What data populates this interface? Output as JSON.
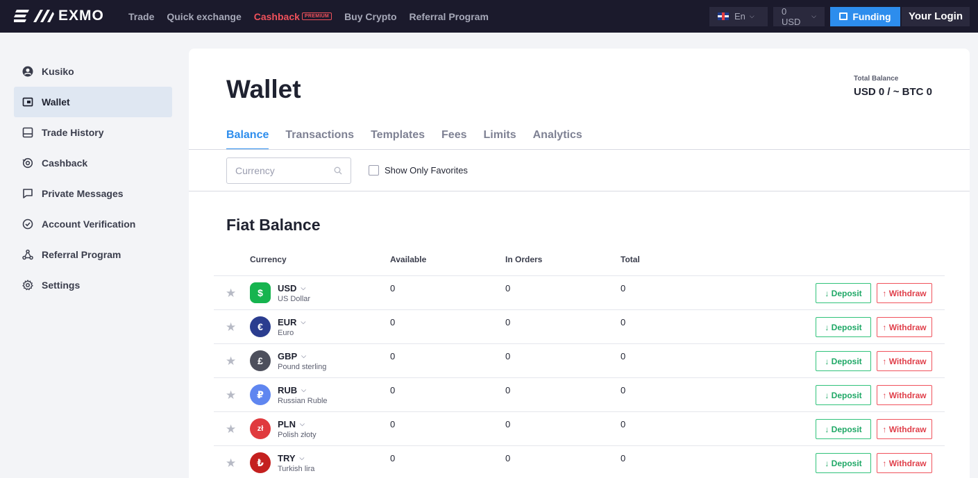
{
  "brand": {
    "name": "EXMO"
  },
  "nav": {
    "items": [
      {
        "label": "Trade"
      },
      {
        "label": "Quick exchange"
      },
      {
        "label": "Cashback"
      },
      {
        "label": "Buy Crypto"
      },
      {
        "label": "Referral Program"
      }
    ],
    "premium_badge": "PREMIUM"
  },
  "topbar": {
    "language": "En",
    "balance": "0 USD",
    "funding_label": "Funding",
    "login_label": "Your Login"
  },
  "sidebar": {
    "items": [
      {
        "label": "Kusiko",
        "icon": "user-icon"
      },
      {
        "label": "Wallet",
        "icon": "wallet-icon"
      },
      {
        "label": "Trade History",
        "icon": "history-icon"
      },
      {
        "label": "Cashback",
        "icon": "cashback-icon"
      },
      {
        "label": "Private Messages",
        "icon": "message-icon"
      },
      {
        "label": "Account Verification",
        "icon": "check-circle-icon"
      },
      {
        "label": "Referral Program",
        "icon": "referral-icon"
      },
      {
        "label": "Settings",
        "icon": "gear-icon"
      }
    ]
  },
  "main": {
    "title": "Wallet",
    "total_label": "Total Balance",
    "total_value": "USD 0 / ~ BTC 0",
    "tabs": [
      {
        "label": "Balance"
      },
      {
        "label": "Transactions"
      },
      {
        "label": "Templates"
      },
      {
        "label": "Fees"
      },
      {
        "label": "Limits"
      },
      {
        "label": "Analytics"
      }
    ],
    "search_placeholder": "Currency",
    "favorites_label": "Show Only Favorites",
    "section_title": "Fiat Balance",
    "columns": {
      "currency": "Currency",
      "available": "Available",
      "in_orders": "In Orders",
      "total": "Total"
    },
    "deposit_label": "↓ Deposit",
    "withdraw_label": "↑ Withdraw",
    "rows": [
      {
        "code": "USD",
        "name": "US Dollar",
        "symbol": "$",
        "color": "#16b44f",
        "available": "0",
        "in_orders": "0",
        "total": "0"
      },
      {
        "code": "EUR",
        "name": "Euro",
        "symbol": "€",
        "color": "#2b3d8f",
        "available": "0",
        "in_orders": "0",
        "total": "0"
      },
      {
        "code": "GBP",
        "name": "Pound sterling",
        "symbol": "£",
        "color": "#4d4f5c",
        "available": "0",
        "in_orders": "0",
        "total": "0"
      },
      {
        "code": "RUB",
        "name": "Russian Ruble",
        "symbol": "₽",
        "color": "#5f86f0",
        "available": "0",
        "in_orders": "0",
        "total": "0"
      },
      {
        "code": "PLN",
        "name": "Polish złoty",
        "symbol": "zł",
        "color": "#e03a3e",
        "available": "0",
        "in_orders": "0",
        "total": "0"
      },
      {
        "code": "TRY",
        "name": "Turkish lira",
        "symbol": "₺",
        "color": "#c4201f",
        "available": "0",
        "in_orders": "0",
        "total": "0"
      }
    ]
  },
  "colors": {
    "accent": "#2d8ded",
    "topbar": "#1b1a2c",
    "deposit": "#1fa866",
    "withdraw": "#e0404b"
  }
}
